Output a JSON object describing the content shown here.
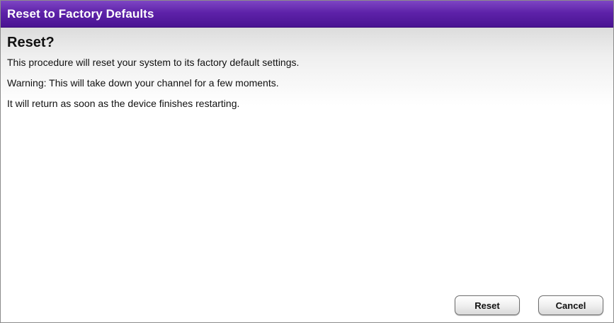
{
  "dialog": {
    "title": "Reset to Factory Defaults",
    "heading": "Reset?",
    "paragraphs": [
      "This procedure will reset your system to its factory default settings.",
      "Warning: This will take down your channel for a few moments.",
      "It will return as soon as the device finishes restarting."
    ],
    "buttons": {
      "reset_label": "Reset",
      "cancel_label": "Cancel"
    }
  },
  "colors": {
    "title_bar": "#5e22a9",
    "title_text": "#ffffff"
  }
}
